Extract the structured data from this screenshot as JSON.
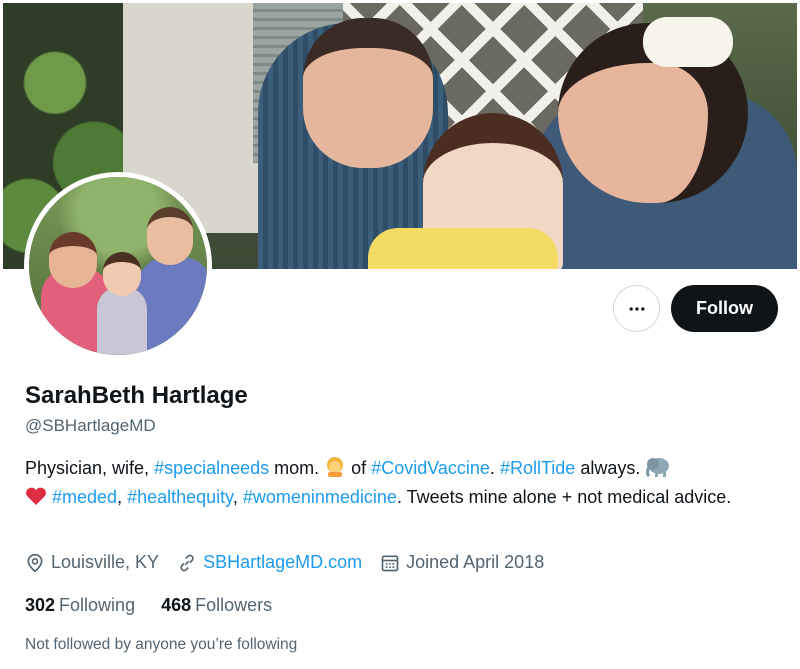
{
  "profile": {
    "display_name": "SarahBeth Hartlage",
    "handle": "@SBHartlageMD",
    "bio": {
      "p1": "Physician, wife, ",
      "tag1": "#specialneeds",
      "p2": " mom. ",
      "p3": " of ",
      "tag2": "#CovidVaccine",
      "p4": ". ",
      "tag3": "#RollTide",
      "p5": " always. ",
      "tag4": "#meded",
      "p6": ", ",
      "tag5": "#healthequity",
      "p7": ", ",
      "tag6": "#womeninmedicine",
      "p8": ". Tweets mine alone + not medical advice."
    },
    "location": "Louisville, KY",
    "website": "SBHartlageMD.com",
    "joined": "Joined April 2018",
    "following_count": "302",
    "following_label": "Following",
    "followers_count": "468",
    "followers_label": "Followers",
    "mutuals_note": "Not followed by anyone you’re following"
  },
  "actions": {
    "more_icon": "more-horizontal-icon",
    "follow_label": "Follow"
  },
  "icons": {
    "location": "location-pin-icon",
    "link": "link-icon",
    "calendar": "calendar-icon",
    "emoji_person": "person-emoji-icon",
    "emoji_elephant": "elephant-emoji-icon",
    "emoji_heart": "red-heart-emoji-icon"
  },
  "colors": {
    "accent": "#1d9bf0",
    "text": "#0f1419",
    "secondary": "#536471",
    "follow_bg": "#0f1419"
  }
}
